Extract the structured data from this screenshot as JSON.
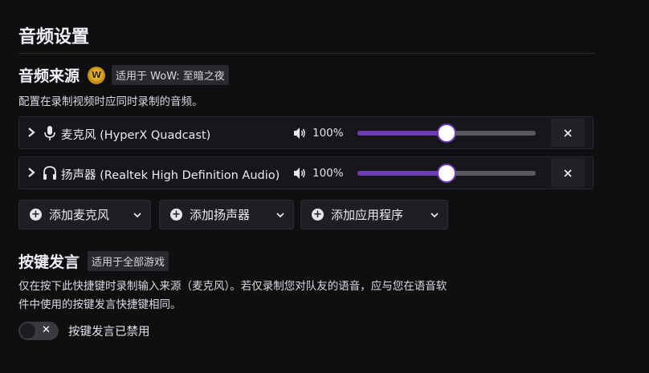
{
  "page": {
    "title": "音频设置"
  },
  "audio_source": {
    "title": "音频来源",
    "game_tag": "适用于 WoW: 至暗之夜",
    "description": "配置在录制视频时应同时录制的音频。",
    "devices": [
      {
        "icon": "microphone-icon",
        "name": "麦克风 (HyperX Quadcast)",
        "volume_label": "100%",
        "volume": 0.5
      },
      {
        "icon": "headphones-icon",
        "name": "扬声器 (Realtek High Definition Audio)",
        "volume_label": "100%",
        "volume": 0.5
      }
    ],
    "add_buttons": [
      {
        "label": "添加麦克风"
      },
      {
        "label": "添加扬声器"
      },
      {
        "label": "添加应用程序"
      }
    ],
    "remove_icon": "close-icon"
  },
  "push_to_talk": {
    "title": "按键发言",
    "tag": "适用于全部游戏",
    "description_line1": "仅在按下此快捷键时录制输入来源（麦克风）。若仅录制您对队友的语音，应与您在语音软",
    "description_line2": "件中使用的按键发言快捷键相同。",
    "toggle_label": "按键发言已禁用",
    "toggle_on": false
  },
  "colors": {
    "accent": "#6c3bb5",
    "background": "#0f0e10",
    "panel": "#17161a"
  }
}
